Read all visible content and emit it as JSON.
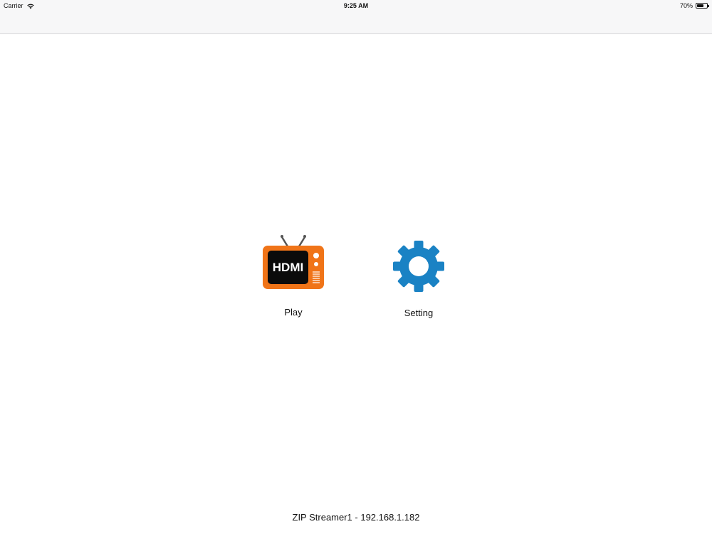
{
  "status_bar": {
    "carrier": "Carrier",
    "time": "9:25 AM",
    "battery_percent": "70%",
    "battery_level": 0.7,
    "wifi_icon": "wifi-icon",
    "battery_icon": "battery-icon"
  },
  "main": {
    "tiles": [
      {
        "label": "Play",
        "icon": "hdmi-tv-icon",
        "icon_text": "HDMI"
      },
      {
        "label": "Setting",
        "icon": "gear-icon"
      }
    ]
  },
  "footer": {
    "device_info": "ZIP Streamer1 - 192.168.1.182"
  },
  "colors": {
    "tv_orange": "#f07418",
    "gear_blue": "#1a82c4",
    "nav_background": "#f7f7f8"
  }
}
